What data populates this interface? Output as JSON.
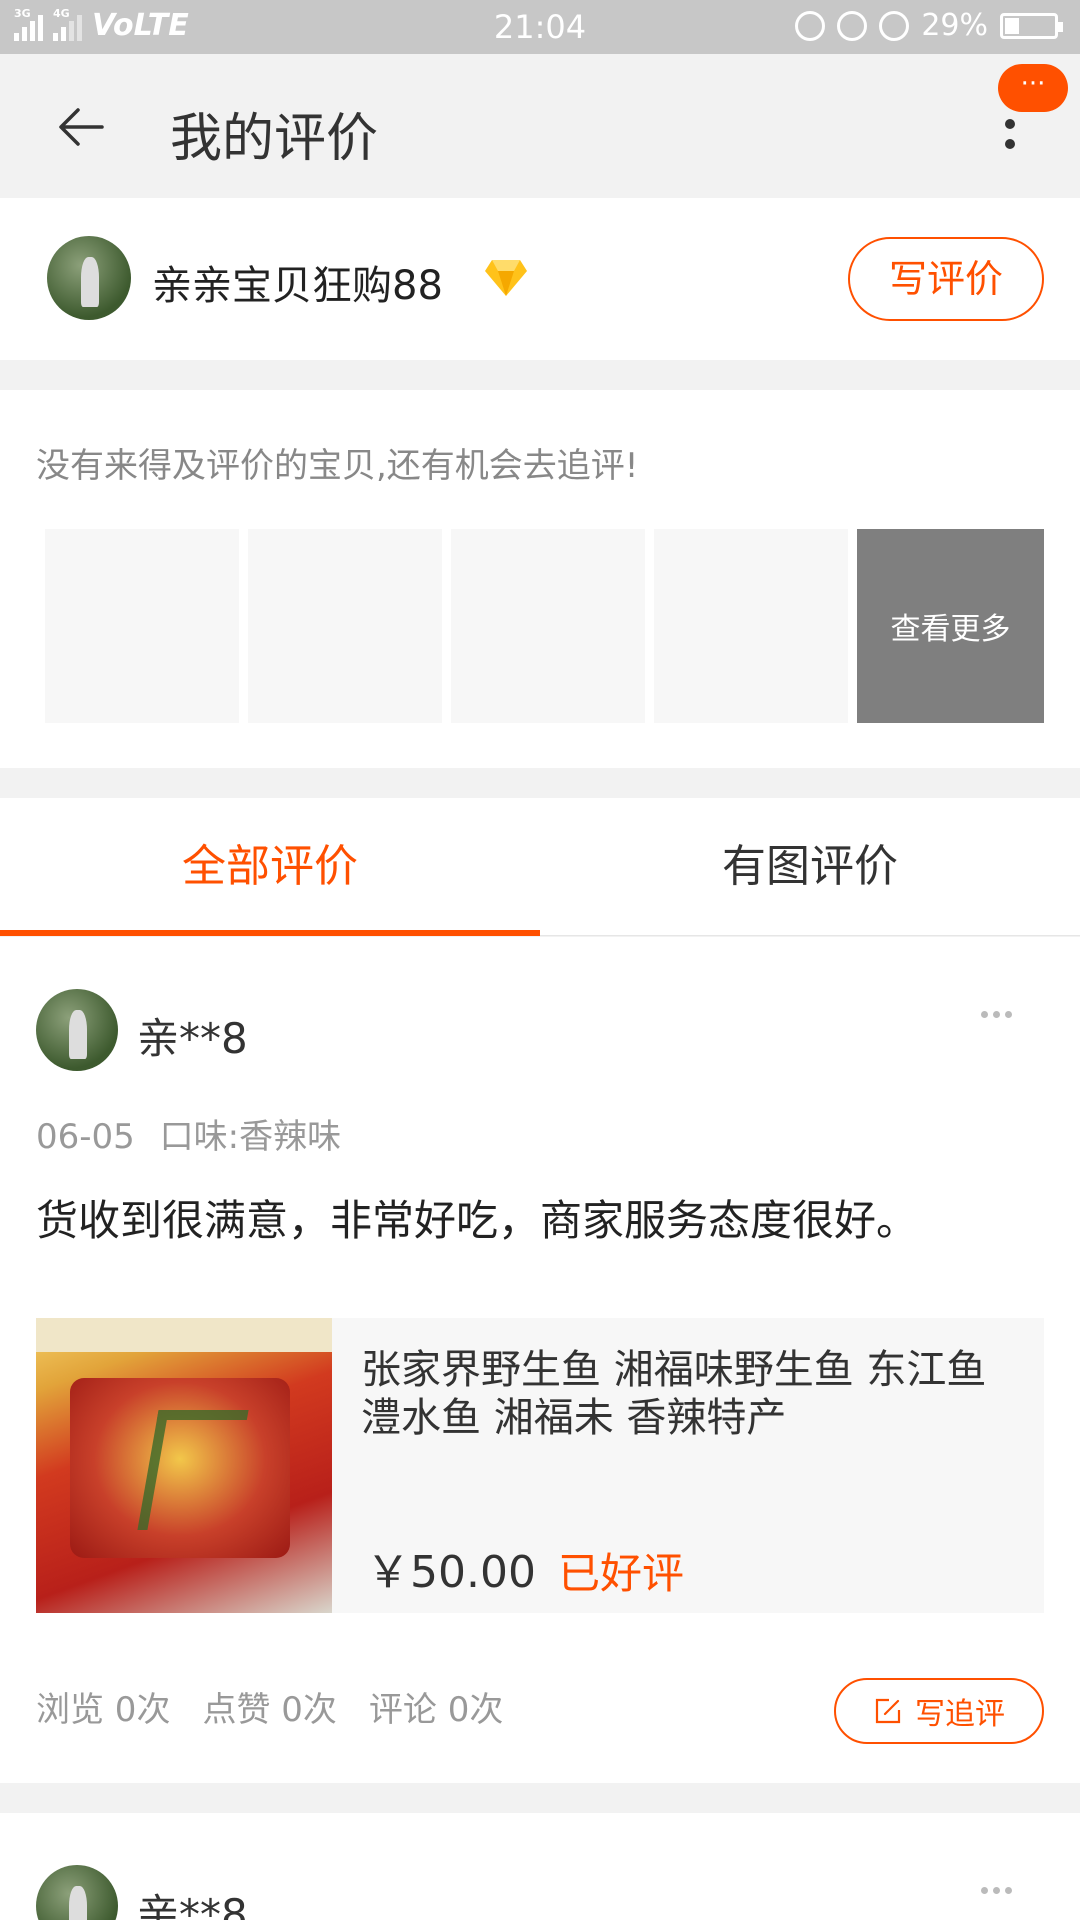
{
  "status_bar": {
    "network_3g": "3G",
    "network_4g": "4G",
    "volte": "VoLTE",
    "time": "21:04",
    "battery_percent": "29%",
    "battery_level": 0.29
  },
  "header": {
    "title": "我的评价",
    "message_badge": "···"
  },
  "user": {
    "name": "亲亲宝贝狂购88",
    "write_review_label": "写评价",
    "accent_color": "#ff5000"
  },
  "pending": {
    "hint": "没有来得及评价的宝贝,还有机会去追评!",
    "see_more_label": "查看更多"
  },
  "tabs": [
    {
      "label": "全部评价",
      "active": true
    },
    {
      "label": "有图评价",
      "active": false
    }
  ],
  "reviews": [
    {
      "user_name": "亲**8",
      "date": "06-05",
      "spec": "口味:香辣味",
      "text": "货收到很满意，非常好吃，商家服务态度很好。",
      "product": {
        "title": "张家界野生鱼 湘福味野生鱼 东江鱼 澧水鱼 湘福未  香辣特产",
        "price": "￥50.00",
        "status": "已好评"
      },
      "stats": {
        "views": "浏览 0次",
        "likes": "点赞 0次",
        "comments": "评论 0次"
      },
      "follow_up_label": "写追评"
    },
    {
      "user_name": "亲**8"
    }
  ]
}
